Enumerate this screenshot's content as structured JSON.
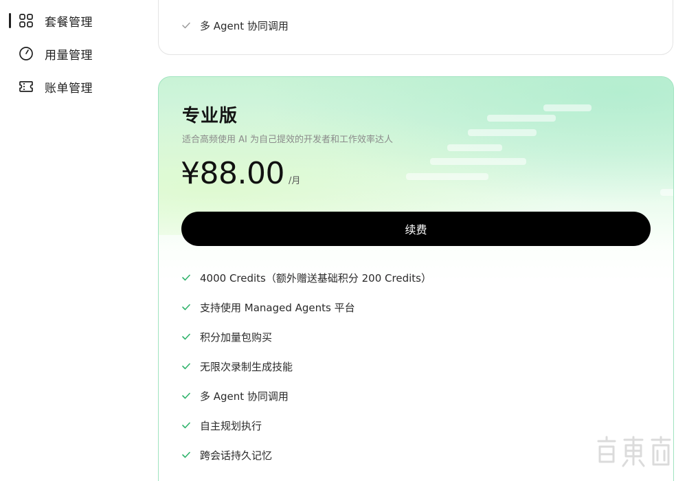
{
  "sidebar": {
    "items": [
      {
        "label": "套餐管理",
        "icon": "grid-icon",
        "active": true
      },
      {
        "label": "用量管理",
        "icon": "gauge-icon",
        "active": false
      },
      {
        "label": "账单管理",
        "icon": "ticket-icon",
        "active": false
      }
    ]
  },
  "prev_card": {
    "feature": "多 Agent 协同调用"
  },
  "pro_card": {
    "title": "专业版",
    "subtitle": "适合高频使用 AI 为自己提效的开发者和工作效率达人",
    "price": "¥88.00",
    "period": "/月",
    "button_label": "续费",
    "features": [
      "4000 Credits（额外赠送基础积分 200 Credits）",
      "支持使用 Managed Agents 平台",
      "积分加量包购买",
      "无限次录制生成技能",
      "多 Agent 协同调用",
      "自主规划执行",
      "跨会话持久记忆"
    ]
  },
  "colors": {
    "check": "#2fb36b",
    "button_bg": "#000000",
    "card_border": "#9fe3bf",
    "gradient_top": "#c9f3d6"
  }
}
